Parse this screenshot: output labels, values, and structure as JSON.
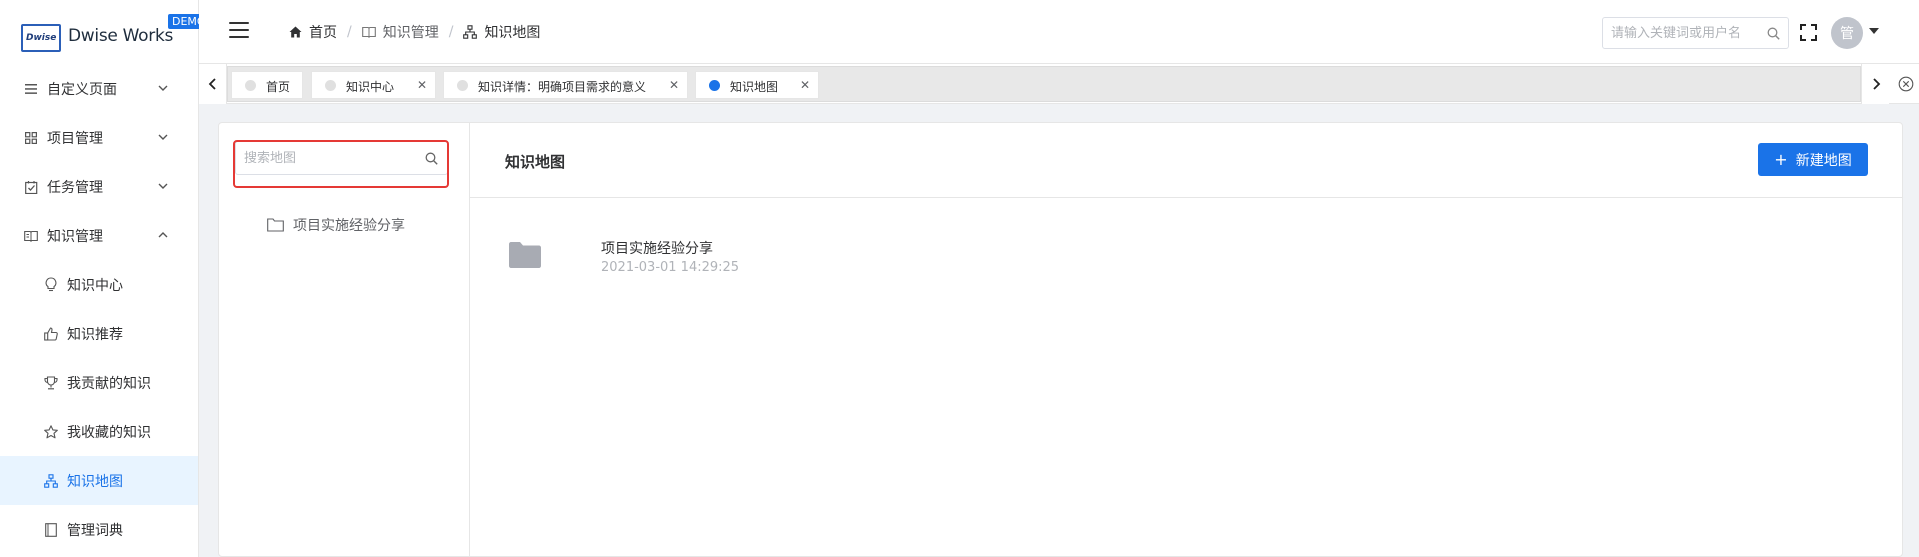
{
  "brand": {
    "box_text": "Dwise",
    "name": "Dwise Works",
    "badge": "DEMO"
  },
  "sidebar": {
    "menus": [
      {
        "label": "自定义页面",
        "icon": "list-icon",
        "expanded": false
      },
      {
        "label": "项目管理",
        "icon": "grid-icon",
        "expanded": false
      },
      {
        "label": "任务管理",
        "icon": "check-square-icon",
        "expanded": false
      },
      {
        "label": "知识管理",
        "icon": "book-icon",
        "expanded": true
      }
    ],
    "subitems": [
      {
        "label": "知识中心",
        "icon": "lightbulb-icon"
      },
      {
        "label": "知识推荐",
        "icon": "thumbs-up-icon"
      },
      {
        "label": "我贡献的知识",
        "icon": "trophy-icon"
      },
      {
        "label": "我收藏的知识",
        "icon": "star-icon"
      },
      {
        "label": "知识地图",
        "icon": "sitemap-icon",
        "active": true
      },
      {
        "label": "管理词典",
        "icon": "document-icon"
      }
    ]
  },
  "header": {
    "breadcrumb": [
      "首页",
      "知识管理",
      "知识地图"
    ],
    "search_placeholder": "请输入关键词或用户名",
    "avatar_text": "管"
  },
  "tabs": [
    {
      "label": "首页",
      "closable": false,
      "active": false
    },
    {
      "label": "知识中心",
      "closable": true,
      "active": false
    },
    {
      "label": "知识详情：明确项目需求的意义",
      "closable": true,
      "active": false
    },
    {
      "label": "知识地图",
      "closable": true,
      "active": true
    }
  ],
  "left_panel": {
    "search_placeholder": "搜索地图",
    "tree": [
      {
        "label": "项目实施经验分享"
      }
    ]
  },
  "main": {
    "title": "知识地图",
    "new_button": "新建地图",
    "maps": [
      {
        "name": "项目实施经验分享",
        "created": "2021-03-01 14:29:25"
      }
    ]
  },
  "colors": {
    "accent": "#1a73e8",
    "highlight": "#e53935"
  }
}
